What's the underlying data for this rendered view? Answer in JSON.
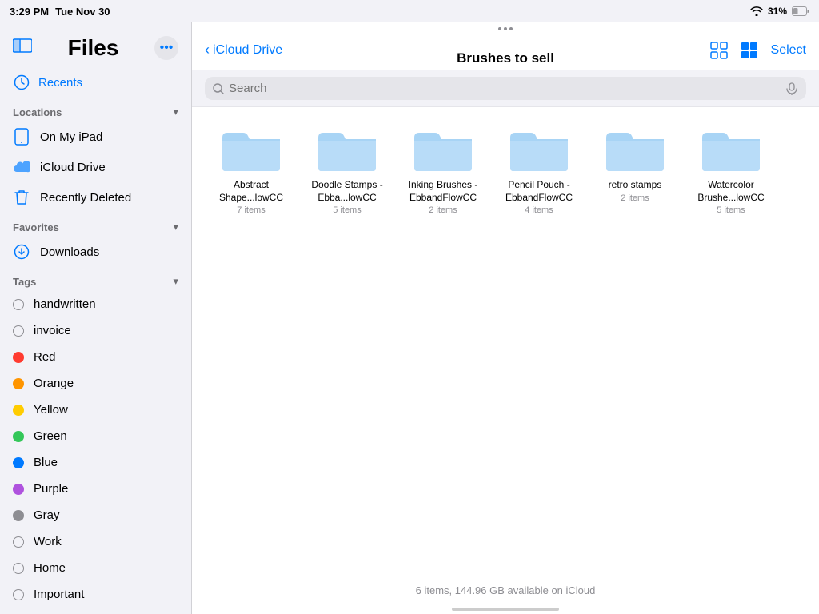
{
  "statusBar": {
    "time": "3:29 PM",
    "date": "Tue Nov 30",
    "wifi": "wifi",
    "battery": "31%"
  },
  "sidebar": {
    "title": "Files",
    "moreButton": "•••",
    "recents": "Recents",
    "sections": {
      "locations": {
        "label": "Locations",
        "items": [
          {
            "id": "on-my-ipad",
            "label": "On My iPad",
            "icon": "tablet"
          },
          {
            "id": "icloud-drive",
            "label": "iCloud Drive",
            "icon": "cloud"
          },
          {
            "id": "recently-deleted",
            "label": "Recently Deleted",
            "icon": "trash"
          }
        ]
      },
      "favorites": {
        "label": "Favorites",
        "items": [
          {
            "id": "downloads",
            "label": "Downloads",
            "icon": "download"
          }
        ]
      },
      "tags": {
        "label": "Tags",
        "items": [
          {
            "id": "handwritten",
            "label": "handwritten",
            "color": null
          },
          {
            "id": "invoice",
            "label": "invoice",
            "color": null
          },
          {
            "id": "red",
            "label": "Red",
            "color": "#ff3b30"
          },
          {
            "id": "orange",
            "label": "Orange",
            "color": "#ff9500"
          },
          {
            "id": "yellow",
            "label": "Yellow",
            "color": "#ffcc00"
          },
          {
            "id": "green",
            "label": "Green",
            "color": "#34c759"
          },
          {
            "id": "blue",
            "label": "Blue",
            "color": "#007aff"
          },
          {
            "id": "purple",
            "label": "Purple",
            "color": "#af52de"
          },
          {
            "id": "gray",
            "label": "Gray",
            "color": "#8e8e93"
          },
          {
            "id": "work",
            "label": "Work",
            "color": null
          },
          {
            "id": "home",
            "label": "Home",
            "color": null
          },
          {
            "id": "important",
            "label": "Important",
            "color": null
          }
        ]
      }
    }
  },
  "header": {
    "backLabel": "iCloud Drive",
    "title": "Brushes to sell",
    "selectLabel": "Select"
  },
  "search": {
    "placeholder": "Search"
  },
  "folders": [
    {
      "id": "abstract-shapes",
      "name": "Abstract Shape...lowCC",
      "count": "7 items"
    },
    {
      "id": "doodle-stamps",
      "name": "Doodle Stamps - Ebba...lowCC",
      "count": "5 items"
    },
    {
      "id": "inking-brushes",
      "name": "Inking Brushes - EbbandFlowCC",
      "count": "2 items"
    },
    {
      "id": "pencil-pouch",
      "name": "Pencil Pouch - EbbandFlowCC",
      "count": "4 items"
    },
    {
      "id": "retro-stamps",
      "name": "retro stamps",
      "count": "2 items"
    },
    {
      "id": "watercolor-brushes",
      "name": "Watercolor Brushe...lowCC",
      "count": "5 items"
    }
  ],
  "footer": {
    "info": "6 items, 144.96 GB available on iCloud"
  }
}
